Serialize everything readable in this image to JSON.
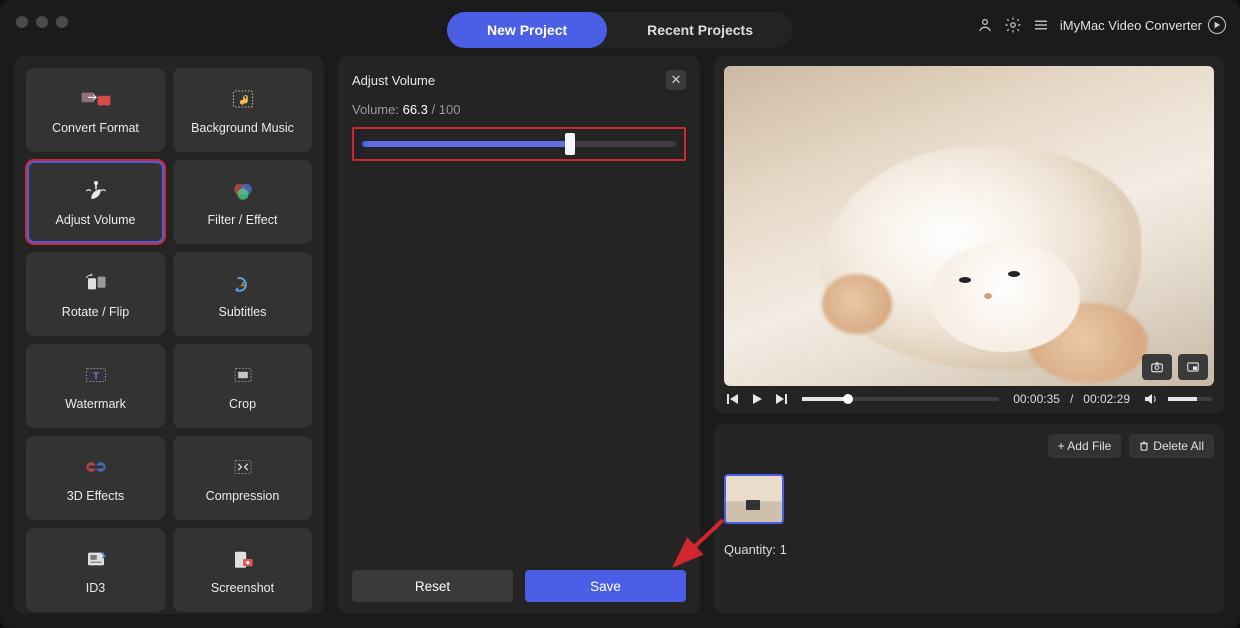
{
  "app_name": "iMyMac Video Converter",
  "window_tabs": {
    "new_project": "New Project",
    "recent_projects": "Recent Projects"
  },
  "tools": [
    {
      "label": "Convert Format"
    },
    {
      "label": "Background Music"
    },
    {
      "label": "Adjust Volume"
    },
    {
      "label": "Filter / Effect"
    },
    {
      "label": "Rotate / Flip"
    },
    {
      "label": "Subtitles"
    },
    {
      "label": "Watermark"
    },
    {
      "label": "Crop"
    },
    {
      "label": "3D Effects"
    },
    {
      "label": "Compression"
    },
    {
      "label": "ID3"
    },
    {
      "label": "Screenshot"
    }
  ],
  "panel": {
    "title": "Adjust Volume",
    "volume_label": "Volume: ",
    "volume_value": "66.3",
    "volume_sep": " / ",
    "volume_max": "100",
    "reset": "Reset",
    "save": "Save",
    "slider_percent": 66.3
  },
  "player": {
    "current": "00:00:35",
    "duration": "00:02:29",
    "progress_percent": 23.5,
    "volume_percent": 65
  },
  "queue": {
    "add_file": "+  Add File",
    "delete_all": "Delete All",
    "quantity_label": "Quantity: ",
    "quantity": "1"
  }
}
